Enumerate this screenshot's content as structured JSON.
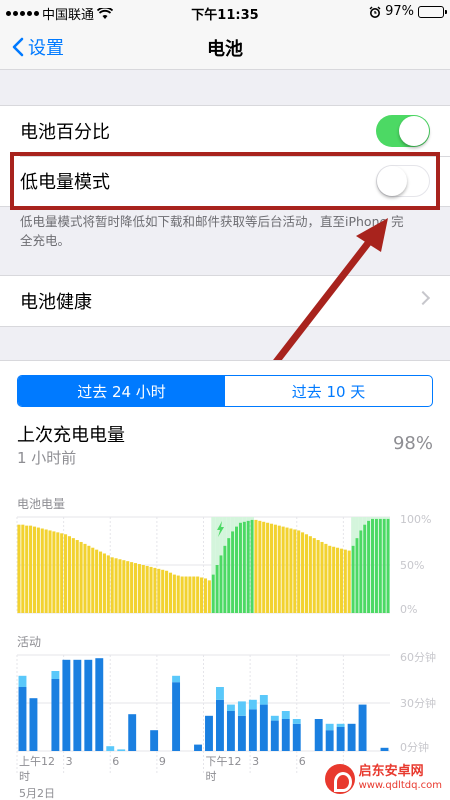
{
  "status_bar": {
    "carrier": "中国联通",
    "time": "下午11:35",
    "battery_percent": "97%",
    "battery_level": 0.97
  },
  "nav": {
    "back_label": "设置",
    "title": "电池"
  },
  "settings": {
    "battery_percentage_label": "电池百分比",
    "battery_percentage_on": true,
    "low_power_label": "低电量模式",
    "low_power_on": false,
    "low_power_footnote": "低电量模式将暂时降低如下载和邮件获取等后台活动，直至iPhone 完全充电。",
    "battery_health_label": "电池健康"
  },
  "segment": {
    "tab_24h": "过去 24 小时",
    "tab_10d": "过去 10 天",
    "active": "24h"
  },
  "last_charge": {
    "title": "上次充电电量",
    "subtitle": "1 小时前",
    "value": "98%"
  },
  "colors": {
    "accent": "#007aff",
    "toggle_on": "#4cd964",
    "battery_normal": "#f2d230",
    "battery_charging": "#4cd964",
    "activity_screen_on": "#1a7fe0",
    "activity_screen_off": "#5ac8fa",
    "annotation": "#a8231d"
  },
  "chart_data": [
    {
      "type": "bar",
      "title": "电池电量",
      "y_ticks": [
        "100%",
        "50%",
        "0%"
      ],
      "ylim": [
        0,
        100
      ],
      "x": [
        0,
        1,
        2,
        3,
        4,
        5,
        6,
        7,
        8,
        9,
        10,
        11,
        12,
        13,
        14,
        15,
        16,
        17,
        18,
        19,
        20,
        21,
        22,
        23,
        24,
        25,
        26,
        27,
        28,
        29,
        30,
        31,
        32,
        33,
        34,
        35,
        36,
        37,
        38,
        39,
        40,
        41,
        42,
        43,
        44,
        45,
        46,
        47,
        48,
        49,
        50,
        51,
        52,
        53,
        54,
        55,
        56,
        57,
        58,
        59,
        60,
        61,
        62,
        63,
        64,
        65,
        66,
        67,
        68,
        69,
        70,
        71,
        72,
        73,
        74,
        75,
        76,
        77,
        78,
        79,
        80,
        81,
        82,
        83,
        84,
        85,
        86,
        87,
        88,
        89,
        90,
        91,
        92,
        93,
        94,
        95
      ],
      "values": [
        92,
        92,
        91,
        91,
        90,
        89,
        88,
        87,
        86,
        85,
        84,
        83,
        82,
        80,
        78,
        76,
        74,
        72,
        70,
        68,
        66,
        64,
        62,
        60,
        58,
        57,
        56,
        55,
        54,
        53,
        52,
        51,
        50,
        49,
        48,
        47,
        46,
        45,
        44,
        42,
        40,
        39,
        38,
        38,
        38,
        38,
        38,
        37,
        36,
        34,
        40,
        50,
        60,
        70,
        78,
        85,
        90,
        94,
        95,
        96,
        97,
        97,
        96,
        95,
        94,
        93,
        92,
        91,
        90,
        89,
        88,
        87,
        86,
        84,
        82,
        80,
        78,
        76,
        74,
        72,
        70,
        69,
        68,
        67,
        66,
        65,
        70,
        78,
        86,
        92,
        96,
        98,
        98,
        98,
        98,
        98
      ],
      "charging": [
        0,
        0,
        0,
        0,
        0,
        0,
        0,
        0,
        0,
        0,
        0,
        0,
        0,
        0,
        0,
        0,
        0,
        0,
        0,
        0,
        0,
        0,
        0,
        0,
        0,
        0,
        0,
        0,
        0,
        0,
        0,
        0,
        0,
        0,
        0,
        0,
        0,
        0,
        0,
        0,
        0,
        0,
        0,
        0,
        0,
        0,
        0,
        0,
        0,
        0,
        1,
        1,
        1,
        1,
        1,
        1,
        1,
        1,
        1,
        1,
        1,
        0,
        0,
        0,
        0,
        0,
        0,
        0,
        0,
        0,
        0,
        0,
        0,
        0,
        0,
        0,
        0,
        0,
        0,
        0,
        0,
        0,
        0,
        0,
        0,
        0,
        1,
        1,
        1,
        1,
        1,
        1,
        1,
        1,
        1,
        1
      ]
    },
    {
      "type": "bar",
      "title": "活动",
      "y_ticks": [
        "60分钟",
        "30分钟",
        "0分钟"
      ],
      "ylim": [
        0,
        60
      ],
      "x_ticks": [
        "上午12",
        "3",
        "6",
        "9",
        "下午12",
        "3",
        "6"
      ],
      "x_sub": [
        "时",
        "",
        "",
        "",
        "时",
        "",
        ""
      ],
      "date_label": "5月2日",
      "series": [
        {
          "name": "screen_on",
          "values": [
            40,
            33,
            0,
            45,
            57,
            57,
            57,
            58,
            0,
            0,
            23,
            0,
            13,
            0,
            43,
            0,
            4,
            22,
            32,
            25,
            22,
            26,
            29,
            19,
            20,
            17,
            0,
            20,
            13,
            15,
            17,
            29,
            0,
            2
          ]
        },
        {
          "name": "screen_off",
          "values": [
            7,
            0,
            0,
            5,
            0,
            0,
            0,
            0,
            3,
            1,
            0,
            0,
            0,
            0,
            4,
            0,
            0,
            0,
            8,
            4,
            9,
            6,
            6,
            3,
            5,
            3,
            0,
            0,
            4,
            2,
            0,
            0,
            0,
            0
          ]
        }
      ]
    }
  ],
  "watermark": {
    "name": "启东安卓网",
    "url": "www.qdltdq.com"
  }
}
